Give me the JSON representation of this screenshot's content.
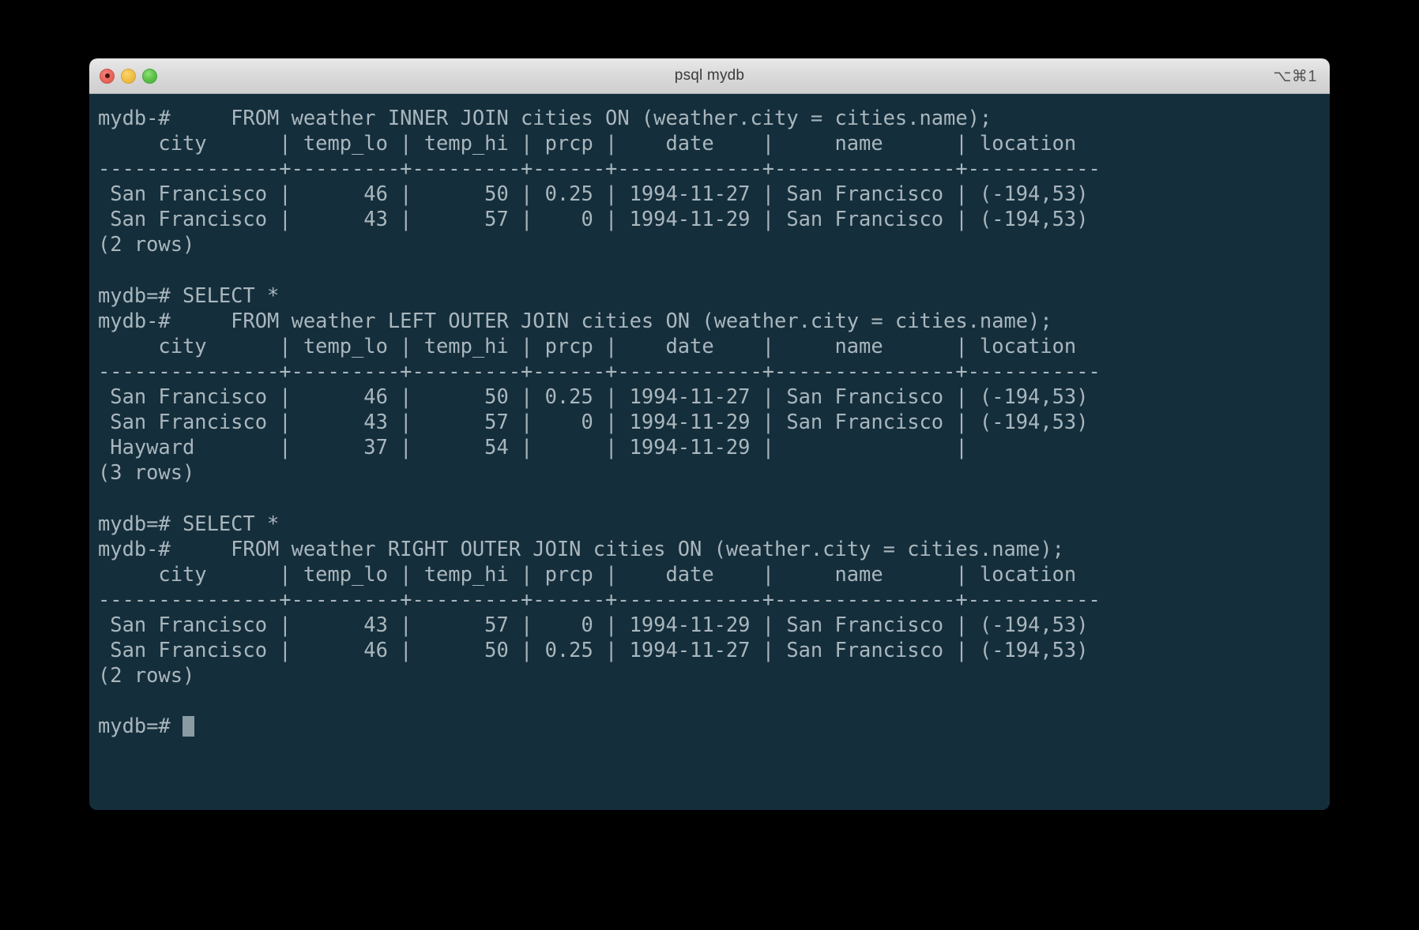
{
  "window": {
    "title": "psql mydb",
    "shortcut_badge": "⌥⌘1",
    "traffic_lights": [
      {
        "name": "close",
        "color": "#ec6a60"
      },
      {
        "name": "minimize",
        "color": "#f3c249"
      },
      {
        "name": "maximize",
        "color": "#62c44d"
      }
    ],
    "colors": {
      "terminal_background": "#152e3c",
      "terminal_foreground": "#a9b7bd",
      "titlebar_background": "#dcdcdc",
      "cursor": "#8b9ba3",
      "desktop_background": "#000000"
    }
  },
  "terminal": {
    "prompt_primary": "mydb=#",
    "prompt_continuation": "mydb-#",
    "cursor_visible": true,
    "lines": [
      "mydb-#     FROM weather INNER JOIN cities ON (weather.city = cities.name);",
      "     city      | temp_lo | temp_hi | prcp |    date    |     name      | location",
      "---------------+---------+---------+------+------------+---------------+-----------",
      " San Francisco |      46 |      50 | 0.25 | 1994-11-27 | San Francisco | (-194,53)",
      " San Francisco |      43 |      57 |    0 | 1994-11-29 | San Francisco | (-194,53)",
      "(2 rows)",
      "",
      "mydb=# SELECT *",
      "mydb-#     FROM weather LEFT OUTER JOIN cities ON (weather.city = cities.name);",
      "     city      | temp_lo | temp_hi | prcp |    date    |     name      | location",
      "---------------+---------+---------+------+------------+---------------+-----------",
      " San Francisco |      46 |      50 | 0.25 | 1994-11-27 | San Francisco | (-194,53)",
      " San Francisco |      43 |      57 |    0 | 1994-11-29 | San Francisco | (-194,53)",
      " Hayward       |      37 |      54 |      | 1994-11-29 |               |",
      "(3 rows)",
      "",
      "mydb=# SELECT *",
      "mydb-#     FROM weather RIGHT OUTER JOIN cities ON (weather.city = cities.name);",
      "     city      | temp_lo | temp_hi | prcp |    date    |     name      | location",
      "---------------+---------+---------+------+------------+---------------+-----------",
      " San Francisco |      43 |      57 |    0 | 1994-11-29 | San Francisco | (-194,53)",
      " San Francisco |      46 |      50 | 0.25 | 1994-11-27 | San Francisco | (-194,53)",
      "(2 rows)",
      ""
    ],
    "final_prompt": "mydb=# ",
    "queries": [
      {
        "join_type": "INNER JOIN",
        "sql_continuation": "FROM weather INNER JOIN cities ON (weather.city = cities.name);",
        "columns": [
          "city",
          "temp_lo",
          "temp_hi",
          "prcp",
          "date",
          "name",
          "location"
        ],
        "rows": [
          [
            "San Francisco",
            "46",
            "50",
            "0.25",
            "1994-11-27",
            "San Francisco",
            "(-194,53)"
          ],
          [
            "San Francisco",
            "43",
            "57",
            "0",
            "1994-11-29",
            "San Francisco",
            "(-194,53)"
          ]
        ],
        "row_count_label": "(2 rows)"
      },
      {
        "join_type": "LEFT OUTER JOIN",
        "sql_first": "SELECT *",
        "sql_continuation": "FROM weather LEFT OUTER JOIN cities ON (weather.city = cities.name);",
        "columns": [
          "city",
          "temp_lo",
          "temp_hi",
          "prcp",
          "date",
          "name",
          "location"
        ],
        "rows": [
          [
            "San Francisco",
            "46",
            "50",
            "0.25",
            "1994-11-27",
            "San Francisco",
            "(-194,53)"
          ],
          [
            "San Francisco",
            "43",
            "57",
            "0",
            "1994-11-29",
            "San Francisco",
            "(-194,53)"
          ],
          [
            "Hayward",
            "37",
            "54",
            "",
            "1994-11-29",
            "",
            ""
          ]
        ],
        "row_count_label": "(3 rows)"
      },
      {
        "join_type": "RIGHT OUTER JOIN",
        "sql_first": "SELECT *",
        "sql_continuation": "FROM weather RIGHT OUTER JOIN cities ON (weather.city = cities.name);",
        "columns": [
          "city",
          "temp_lo",
          "temp_hi",
          "prcp",
          "date",
          "name",
          "location"
        ],
        "rows": [
          [
            "San Francisco",
            "43",
            "57",
            "0",
            "1994-11-29",
            "San Francisco",
            "(-194,53)"
          ],
          [
            "San Francisco",
            "46",
            "50",
            "0.25",
            "1994-11-27",
            "San Francisco",
            "(-194,53)"
          ]
        ],
        "row_count_label": "(2 rows)"
      }
    ]
  }
}
